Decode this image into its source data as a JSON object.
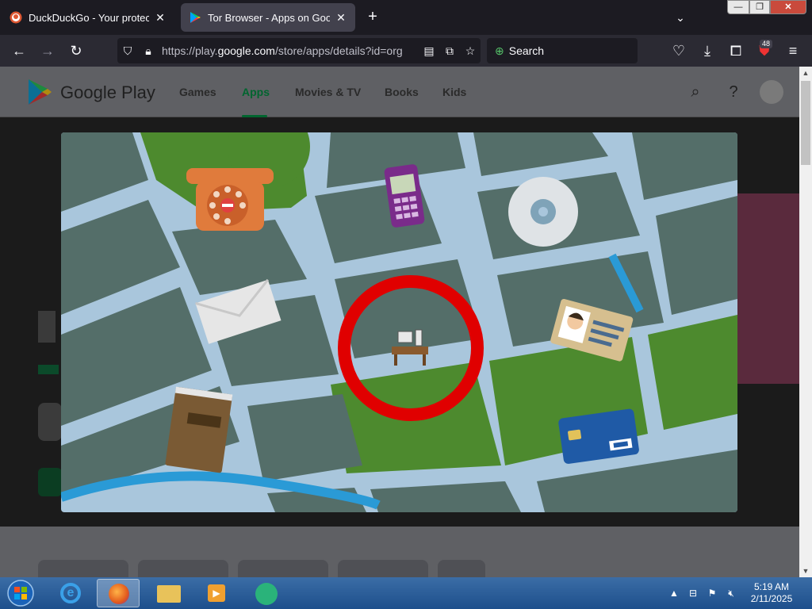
{
  "browser": {
    "tabs": [
      {
        "title": "DuckDuckGo - Your protection",
        "active": false
      },
      {
        "title": "Tor Browser - Apps on Google P",
        "active": true
      }
    ],
    "new_tab": "+",
    "tab_list": "⌄",
    "window_controls": {
      "minimize": "—",
      "maximize": "❐",
      "close": "✕"
    },
    "url": {
      "prefix": "https://play.",
      "host": "google.com",
      "path": "/store/apps/details?id=org"
    },
    "search_label": "Search",
    "extension_badge": "48"
  },
  "google_play": {
    "brand": "Google Play",
    "nav": [
      {
        "label": "Games",
        "active": false
      },
      {
        "label": "Apps",
        "active": true
      },
      {
        "label": "Movies & TV",
        "active": false
      },
      {
        "label": "Books",
        "active": false
      },
      {
        "label": "Kids",
        "active": false
      }
    ]
  },
  "modal": {
    "illustration": "map-illustration",
    "colors": {
      "road": "#a9c6dc",
      "block": "#546e69",
      "park": "#4d8a2e",
      "highlight": "#e00000",
      "water": "#2a9ad6"
    }
  },
  "taskbar": {
    "clock": {
      "time": "5:19 AM",
      "date": "2/11/2025"
    }
  }
}
